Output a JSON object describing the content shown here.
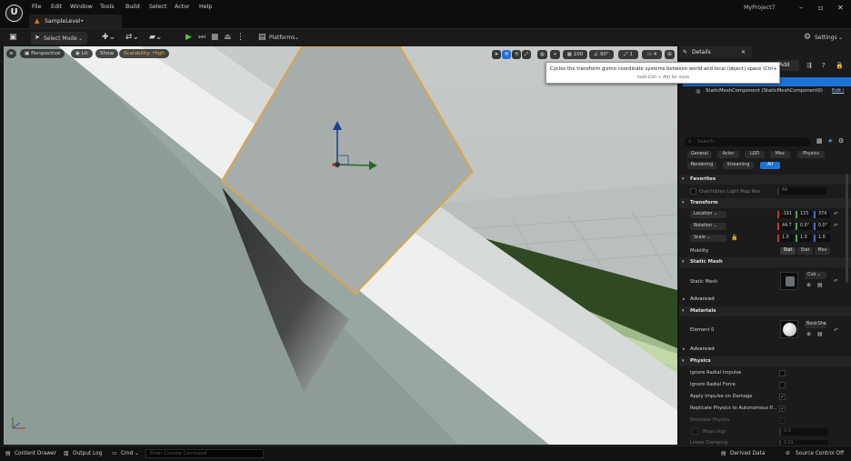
{
  "titlebar": {
    "menu": [
      "File",
      "Edit",
      "Window",
      "Tools",
      "Build",
      "Select",
      "Actor",
      "Help"
    ],
    "level_tab": "SampleLevel•",
    "project_name": "MyProject7"
  },
  "toolbar": {
    "select_mode": "Select Mode",
    "platforms": "Platforms",
    "settings": "Settings"
  },
  "viewport": {
    "perspective": "Perspective",
    "lit": "Lit",
    "show": "Show",
    "scalability": "Scalability: High",
    "grid_snap": "100",
    "rotation_snap": "90°",
    "scale_snap": "1",
    "camera_speed": "4",
    "tooltip_main": "Cycles the transform gizmo coordinate systems between world and local (object) space (Ctrl+`)",
    "tooltip_sub": "hold (Ctrl + Alt) for more"
  },
  "details": {
    "tab_title": "Details",
    "add_label": "Add",
    "component": "StaticMeshComponent (StaticMeshComponent0)",
    "component_edit": "Edit i",
    "search_placeholder": "Search",
    "filters": [
      "General",
      "Actor",
      "LOD",
      "Misc",
      "Physics",
      "Rendering",
      "Streaming",
      "All"
    ],
    "sections": {
      "favorites": "Favorites",
      "transform": "Transform",
      "static_mesh": "Static Mesh",
      "advanced": "Advanced",
      "materials": "Materials",
      "advanced2": "Advanced",
      "physics": "Physics"
    },
    "favorites_row": {
      "label": "Overridden Light Map Res",
      "value": "64"
    },
    "transform": {
      "location_label": "Location",
      "location": [
        "-191",
        "133",
        "374"
      ],
      "rotation_label": "Rotation",
      "rotation": [
        "44.7",
        "0.0°",
        "0.0°"
      ],
      "scale_label": "Scale",
      "scale": [
        "1.0",
        "1.0",
        "1.0"
      ],
      "mobility_label": "Mobility",
      "mobility_options": [
        "Stat",
        "Stat",
        "Mov"
      ]
    },
    "static_mesh": {
      "label": "Static Mesh",
      "value": "Cub"
    },
    "materials": {
      "element_label": "Element 0",
      "value": "BasicSha"
    },
    "physics": {
      "rows": [
        {
          "label": "Ignore Radial Impulse",
          "checked": false
        },
        {
          "label": "Ignore Radial Force",
          "checked": false
        },
        {
          "label": "Apply Impulse on Damage",
          "checked": true
        },
        {
          "label": "Replicate Physics to Autonomous P...",
          "checked": true
        },
        {
          "label": "Simulate Physics",
          "checked": false
        }
      ],
      "mass_label": "Mass (kg)",
      "mass_value": "0.0",
      "linear_damping_label": "Linear Damping",
      "linear_damping_value": "0.01"
    }
  },
  "statusbar": {
    "content_drawer": "Content Drawer",
    "output_log": "Output Log",
    "cmd": "Cmd",
    "console_placeholder": "Enter Console Command",
    "derived_data": "Derived Data",
    "source_control": "Source Control Off"
  },
  "colors": {
    "accent": "#1f72d8",
    "selection_orange": "#e8a23a",
    "play_green": "#5fbf3a",
    "ground_green": "#2f4a22"
  }
}
